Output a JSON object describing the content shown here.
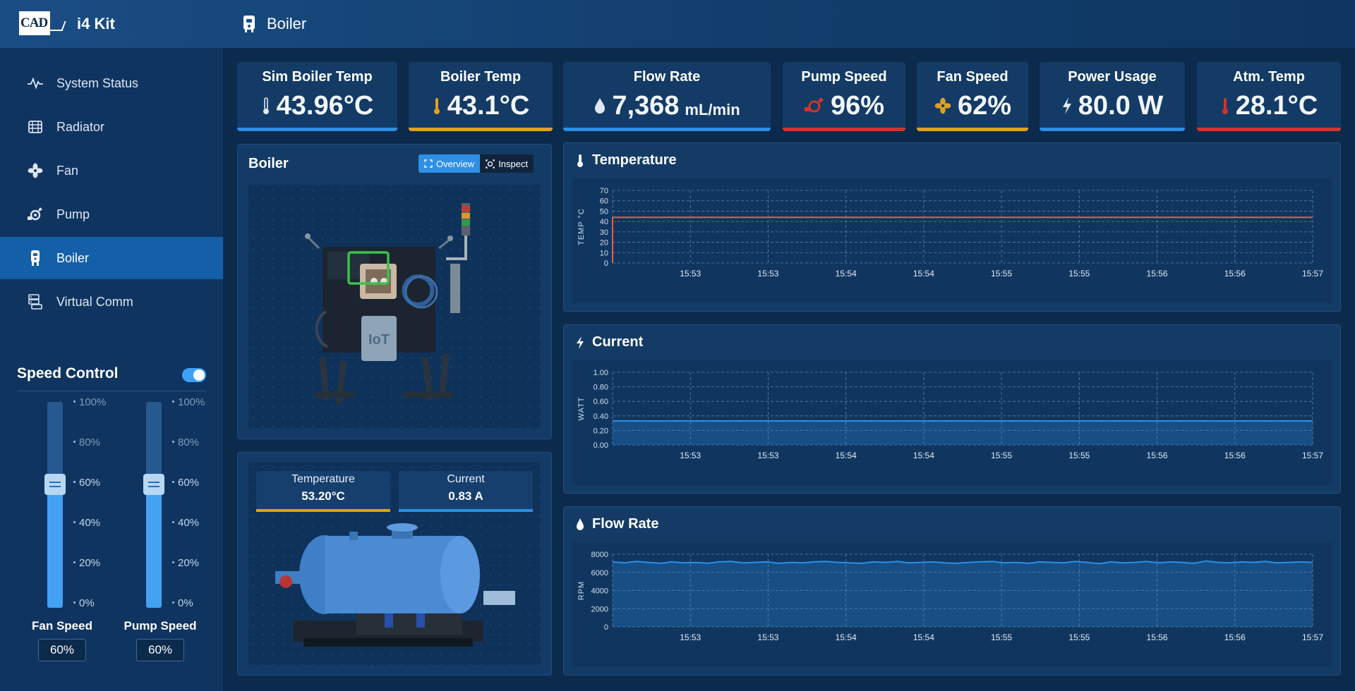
{
  "app": {
    "title": "i4 Kit",
    "logo_text": "CAD"
  },
  "header": {
    "title": "Boiler"
  },
  "sidebar": {
    "items": [
      {
        "label": "System Status",
        "icon": "pulse-icon"
      },
      {
        "label": "Radiator",
        "icon": "radiator-icon"
      },
      {
        "label": "Fan",
        "icon": "fan-icon"
      },
      {
        "label": "Pump",
        "icon": "pump-icon"
      },
      {
        "label": "Boiler",
        "icon": "boiler-icon",
        "active": true
      },
      {
        "label": "Virtual Comm",
        "icon": "server-icon"
      }
    ]
  },
  "speed_control": {
    "title": "Speed Control",
    "enabled": true,
    "ticks": [
      "100%",
      "80%",
      "60%",
      "40%",
      "20%",
      "0%"
    ],
    "fan": {
      "label": "Fan Speed",
      "value": "60%",
      "level": 0.6
    },
    "pump": {
      "label": "Pump Speed",
      "value": "60%",
      "level": 0.6
    }
  },
  "kpis": [
    {
      "title": "Sim Boiler Temp",
      "value": "43.96°C",
      "icon": "thermometer-icon",
      "color": "#2b8fe6"
    },
    {
      "title": "Boiler Temp",
      "value": "43.1°C",
      "icon": "thermometer-icon",
      "color": "#e0a020"
    },
    {
      "title": "Flow Rate",
      "value": "7,368",
      "unit": "mL/min",
      "icon": "droplet-icon",
      "color": "#2b8fe6"
    },
    {
      "title": "Pump Speed",
      "value": "96%",
      "icon": "pump-icon",
      "color": "#d0352e"
    },
    {
      "title": "Fan Speed",
      "value": "62%",
      "icon": "fan-icon",
      "color": "#e0a020"
    },
    {
      "title": "Power Usage",
      "value": "80.0 W",
      "icon": "bolt-icon",
      "color": "#2b8fe6"
    },
    {
      "title": "Atm. Temp",
      "value": "28.1°C",
      "icon": "thermometer-icon",
      "color": "#d0352e"
    }
  ],
  "boiler_panel": {
    "title": "Boiler",
    "view_buttons": {
      "overview": "Overview",
      "inspect": "Inspect"
    },
    "kit_logo_text": "IoT"
  },
  "readings": {
    "temperature": {
      "label": "Temperature",
      "value": "53.20°C",
      "color": "#e0a020"
    },
    "current": {
      "label": "Current",
      "value": "0.83 A",
      "color": "#2b8fe6"
    }
  },
  "chart_data": [
    {
      "type": "line",
      "title": "Temperature",
      "ylabel": "TEMP °C",
      "ylim": [
        0,
        70
      ],
      "yticks": [
        0,
        10,
        20,
        30,
        40,
        50,
        60,
        70
      ],
      "x": [
        "15:53",
        "15:53",
        "15:54",
        "15:54",
        "15:55",
        "15:55",
        "15:56",
        "15:56",
        "15:57"
      ],
      "series": [
        {
          "values": [
            44,
            44,
            44,
            44,
            44,
            44,
            44,
            44,
            44
          ],
          "color": "#e8603c"
        }
      ],
      "grid": true
    },
    {
      "type": "area",
      "title": "Current",
      "ylabel": "WATT",
      "ylim": [
        0,
        1.0
      ],
      "yticks": [
        "0.00",
        "0.20",
        "0.40",
        "0.60",
        "0.80",
        "1.00"
      ],
      "x": [
        "15:53",
        "15:53",
        "15:54",
        "15:54",
        "15:55",
        "15:55",
        "15:56",
        "15:56",
        "15:57"
      ],
      "series": [
        {
          "values": [
            0.33,
            0.33,
            0.33,
            0.33,
            0.33,
            0.33,
            0.33,
            0.33,
            0.33
          ],
          "color": "#2b8fe6"
        }
      ],
      "grid": true
    },
    {
      "type": "area",
      "title": "Flow Rate",
      "ylabel": "RPM",
      "ylim": [
        0,
        8000
      ],
      "yticks": [
        0,
        2000,
        4000,
        6000,
        8000
      ],
      "x": [
        "15:53",
        "15:53",
        "15:54",
        "15:54",
        "15:55",
        "15:55",
        "15:56",
        "15:56",
        "15:57"
      ],
      "series": [
        {
          "values": [
            7150,
            7050,
            7200,
            7100,
            7000,
            7150,
            7050,
            7100,
            7000,
            7150,
            7200,
            7050,
            7100,
            7150,
            7000,
            7100,
            7050,
            7150,
            7200,
            7100,
            7050,
            7000,
            7150,
            7100,
            7200,
            7050,
            7100,
            7150,
            7050,
            7000,
            7100,
            7150,
            7200,
            7050,
            7100,
            7000,
            7150,
            7100,
            7050,
            7200,
            7100,
            6950,
            7150,
            7050,
            7100,
            7200,
            7050,
            7150,
            7100,
            7000,
            7250,
            7100,
            7050,
            7150,
            7100,
            7200,
            7050,
            7100,
            7150,
            7100
          ],
          "color": "#2b8fe6"
        }
      ],
      "grid": true
    }
  ]
}
